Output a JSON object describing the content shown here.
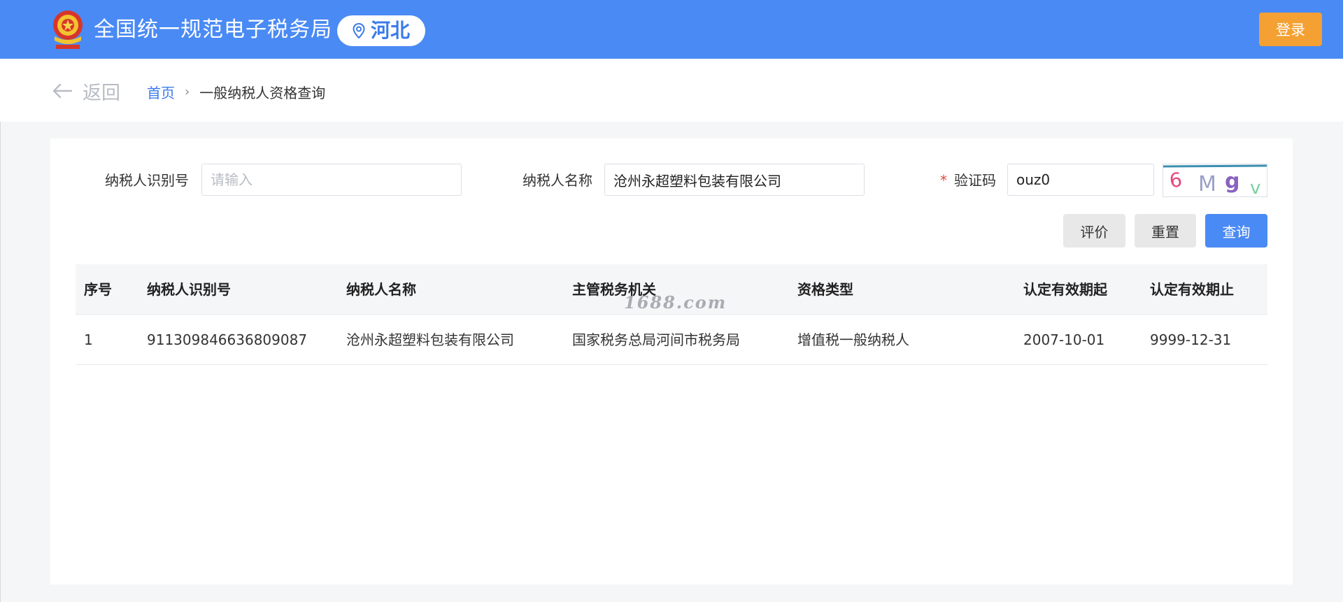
{
  "header": {
    "site_title": "全国统一规范电子税务局",
    "region": "河北",
    "login_label": "登录",
    "colors": {
      "bar": "#4a8af4",
      "login": "#f5a032"
    }
  },
  "nav": {
    "back_label": "返回",
    "breadcrumb_home": "首页",
    "breadcrumb_sep": "›",
    "breadcrumb_current": "一般纳税人资格查询"
  },
  "form": {
    "taxpayer_id_label": "纳税人识别号",
    "taxpayer_id_placeholder": "请输入",
    "taxpayer_id_value": "",
    "taxpayer_name_label": "纳税人名称",
    "taxpayer_name_value": "沧州永超塑料包装有限公司",
    "captcha_required_mark": "*",
    "captcha_label": "验证码",
    "captcha_value": "ouz0",
    "captcha_image_text": [
      "6",
      "M",
      "g",
      "v"
    ],
    "evaluate_label": "评价",
    "reset_label": "重置",
    "query_label": "查询"
  },
  "table": {
    "columns": [
      "序号",
      "纳税人识别号",
      "纳税人名称",
      "主管税务机关",
      "资格类型",
      "认定有效期起",
      "认定有效期止"
    ],
    "rows": [
      [
        "1",
        "911309846636809087",
        "沧州永超塑料包装有限公司",
        "国家税务总局河间市税务局",
        "增值税一般纳税人",
        "2007-10-01",
        "9999-12-31"
      ]
    ]
  },
  "watermark": "1688.com"
}
